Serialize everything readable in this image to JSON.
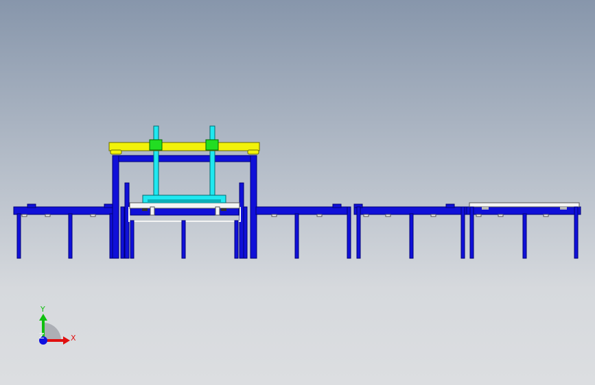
{
  "viewport": {
    "background_top": "#8796ab",
    "background_bottom": "#dcdee1"
  },
  "colors": {
    "frame": "#1010d8",
    "frame_edge": "#000078",
    "gantry_beam": "#f2f20a",
    "gantry_beam_edge": "#6a6a00",
    "rail": "#20e8f0",
    "rail_edge": "#006a70",
    "carriage_block": "#22dd22",
    "carriage_edge": "#006600",
    "plate": "#f4f4f4",
    "plate_edge": "#555555"
  },
  "triad": {
    "x_label": "X",
    "y_label": "Y",
    "z_label": "Z",
    "x_color": "#e01010",
    "y_color": "#10c010",
    "z_color": "#1010e0"
  }
}
